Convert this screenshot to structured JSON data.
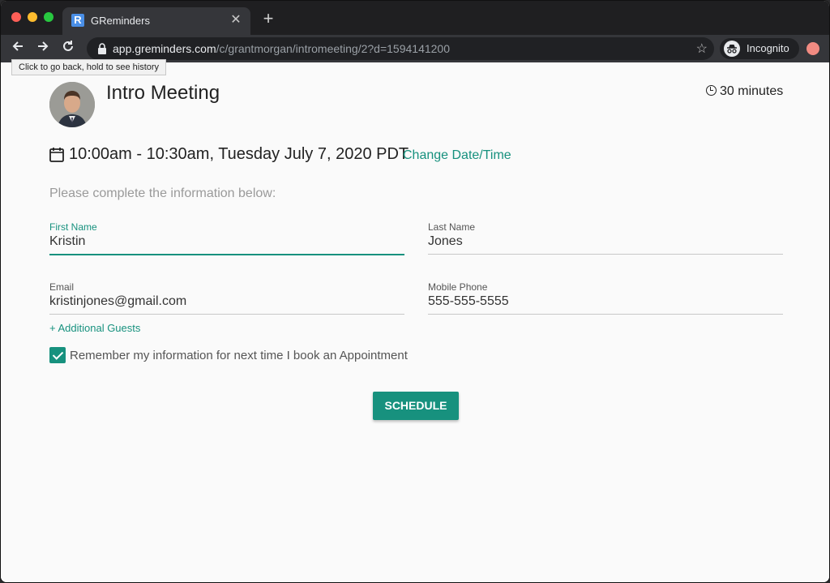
{
  "browser": {
    "tab": {
      "favicon_letter": "R",
      "title": "GReminders"
    },
    "url": {
      "host": "app.greminders.com",
      "path": "/c/grantmorgan/intromeeting/2?d=1594141200"
    },
    "incognito_label": "Incognito",
    "tooltip": "Click to go back, hold to see history"
  },
  "icons": {
    "back": "back-arrow-icon",
    "forward": "forward-arrow-icon",
    "reload": "reload-icon",
    "lock": "lock-icon",
    "star": "bookmark-star-icon",
    "incognito": "incognito-icon",
    "clock": "clock-icon",
    "calendar": "calendar-icon",
    "check": "checkmark-icon"
  },
  "meeting": {
    "title": "Intro Meeting",
    "duration": "30 minutes",
    "datetime": "10:00am - 10:30am, Tuesday July 7, 2020 PDT",
    "change_link": "Change Date/Time"
  },
  "form": {
    "instructions": "Please complete the information below:",
    "first_name": {
      "label": "First Name",
      "value": "Kristin"
    },
    "last_name": {
      "label": "Last Name",
      "value": "Jones"
    },
    "email": {
      "label": "Email",
      "value": "kristinjones@gmail.com"
    },
    "phone": {
      "label": "Mobile Phone",
      "value": "555-555-5555"
    },
    "additional_guests": "+ Additional Guests",
    "remember": {
      "checked": true,
      "label": "Remember my information for next time I book an Appointment"
    },
    "submit_label": "SCHEDULE"
  },
  "colors": {
    "accent": "#17917e",
    "chrome_dark": "#35363a"
  }
}
